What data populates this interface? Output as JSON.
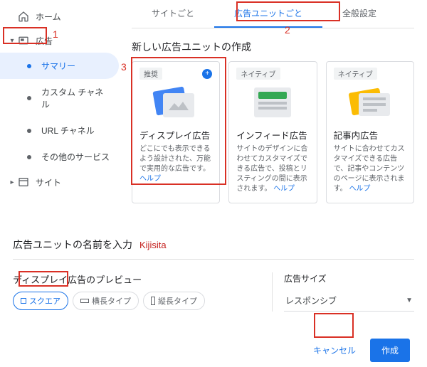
{
  "sidebar": {
    "home": "ホーム",
    "ads": "広告",
    "items": [
      {
        "label": "サマリー",
        "active": true
      },
      {
        "label": "カスタム チャネル",
        "active": false
      },
      {
        "label": "URL チャネル",
        "active": false
      },
      {
        "label": "その他のサービス",
        "active": false
      }
    ],
    "sites": "サイト"
  },
  "tabs": [
    {
      "label": "サイトごと",
      "active": false
    },
    {
      "label": "広告ユニットごと",
      "active": true
    },
    {
      "label": "全般設定",
      "active": false
    }
  ],
  "section_title": "新しい広告ユニットの作成",
  "cards": [
    {
      "badge": "推奨",
      "title": "ディスプレイ広告",
      "desc": "どこにでも表示できるよう設計された、万能で実用的な広告です。",
      "help": "ヘルプ"
    },
    {
      "badge": "ネイティブ",
      "title": "インフィード広告",
      "desc": "サイトのデザインに合わせてカスタマイズできる広告で、投稿とリスティングの間に表示されます。",
      "help": "ヘルプ"
    },
    {
      "badge": "ネイティブ",
      "title": "記事内広告",
      "desc": "サイトに合わせてカスタマイズできる広告で、記事やコンテンツのページに表示されます。",
      "help": "ヘルプ"
    }
  ],
  "naming": {
    "label": "広告ユニットの名前を入力",
    "value_annotation": "Kijisita"
  },
  "preview": {
    "title": "ディスプレイ広告のプレビュー",
    "chips": [
      {
        "label": "スクエア",
        "active": true
      },
      {
        "label": "横長タイプ",
        "active": false
      },
      {
        "label": "縦長タイプ",
        "active": false
      }
    ]
  },
  "size": {
    "title": "広告サイズ",
    "value": "レスポンシブ"
  },
  "footer": {
    "cancel": "キャンセル",
    "create": "作成"
  },
  "annotations": {
    "a1": "1",
    "a2": "2",
    "a3": "3"
  }
}
